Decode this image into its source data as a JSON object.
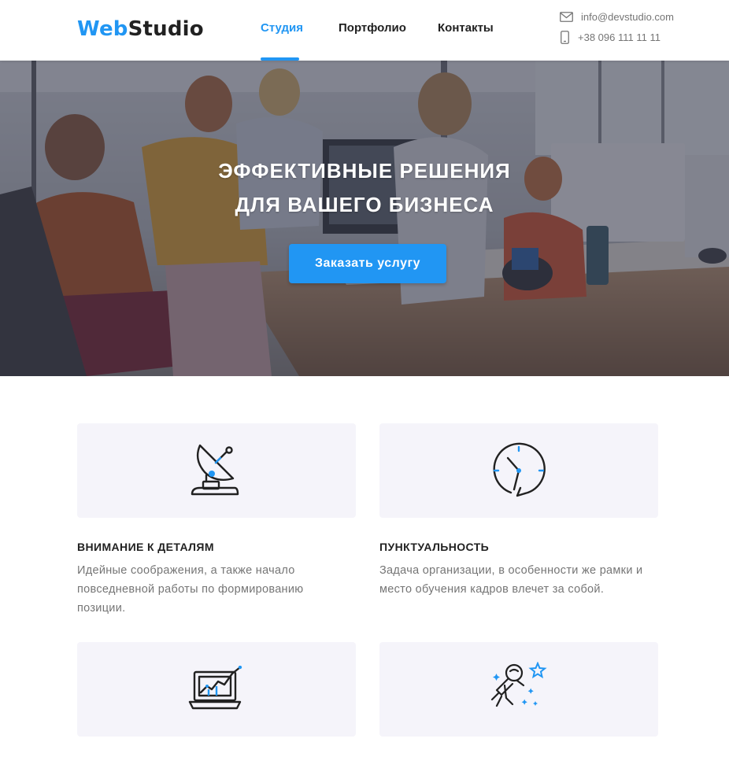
{
  "header": {
    "logo_accent": "Web",
    "logo_rest": "Studio",
    "nav": [
      {
        "label": "Студия",
        "active": true
      },
      {
        "label": "Портфолио",
        "active": false
      },
      {
        "label": "Контакты",
        "active": false
      }
    ],
    "email": "info@devstudio.com",
    "phone": "+38 096 111 11 11"
  },
  "hero": {
    "title_line1": "ЭФФЕКТИВНЫЕ РЕШЕНИЯ",
    "title_line2": "ДЛЯ ВАШЕГО БИЗНЕСА",
    "cta_label": "Заказать услугу"
  },
  "features": [
    {
      "icon": "satellite-dish-icon",
      "title": "ВНИМАНИЕ К ДЕТАЛЯМ",
      "text": "Идейные соображения, а также начало повседневной работы по формированию позиции."
    },
    {
      "icon": "clock-icon",
      "title": "ПУНКТУАЛЬНОСТЬ",
      "text": "Задача организации, в особенности же рамки и место обучения кадров влечет за собой."
    },
    {
      "icon": "laptop-chart-icon",
      "title": "",
      "text": ""
    },
    {
      "icon": "astronaut-icon",
      "title": "",
      "text": ""
    }
  ],
  "colors": {
    "accent": "#2196f3",
    "text": "#212121",
    "muted": "#757575",
    "card_bg": "#f5f4fa"
  }
}
